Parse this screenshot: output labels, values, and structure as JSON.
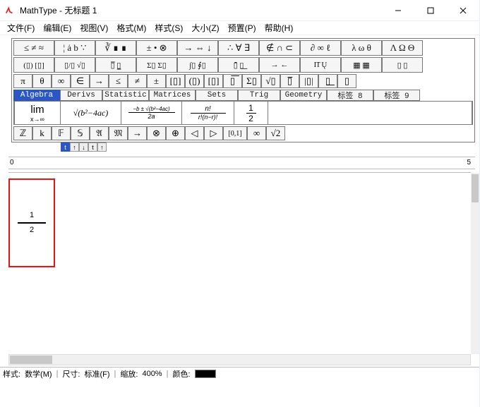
{
  "window": {
    "app_name": "MathType",
    "doc_title": "无标题 1",
    "full_title": "MathType - 无标题 1"
  },
  "menu": {
    "file": "文件(F)",
    "edit": "编辑(E)",
    "view": "视图(V)",
    "format": "格式(M)",
    "style": "样式(S)",
    "size": "大小(Z)",
    "prefs": "预置(P)",
    "help": "帮助(H)"
  },
  "palette_rows": {
    "row1": [
      "≤ ≠ ≈",
      "¦ ȧ b ∵",
      "∛ ∎ ∎",
      "± • ⊗",
      "→ ⇔ ↓",
      "∴ ∀ ∃",
      "∉ ∩ ⊂",
      "∂ ∞ ℓ",
      "λ ω θ",
      "Λ Ω Θ"
    ],
    "row2": [
      "(▯) [▯]",
      "▯/▯  √▯",
      "▯̅  ▯̲",
      "Σ▯ Σ▯",
      "∫▯ ∮▯",
      "▯̄  ▯͟",
      "→  ←",
      "Π̄  Ų",
      "▦ ▦",
      "▯ ▯"
    ]
  },
  "sym_row": [
    "π",
    "θ",
    "∞",
    "∈",
    "→",
    "≤",
    "≠",
    "±",
    "[▯]",
    "(▯)",
    "[▯]",
    "▯͞",
    "Σ▯",
    "√▯",
    "▯̅",
    "|▯|",
    "▯͟",
    "▯"
  ],
  "tabs": {
    "algebra": "Algebra",
    "derivs": "Derivs",
    "statistic": "Statistic",
    "matrices": "Matrices",
    "sets": "Sets",
    "trig": "Trig",
    "geometry": "Geometry",
    "tag8": "标签 8",
    "tag9": "标签 9"
  },
  "templates": {
    "lim": "lim",
    "lim_sub": "x→∞",
    "sqrt": "√(b²−4ac)",
    "quad_top": "−b ± √(b²−4ac)",
    "quad_bot": "2a",
    "binom_top": "n!",
    "binom_bot": "r!(n−r)!",
    "half_top": "1",
    "half_bot": "2"
  },
  "sym_row2": [
    "ℤ",
    "k",
    "𝔽",
    "𝕊",
    "𝔄",
    "𝔐",
    "→",
    "⊗",
    "⊕",
    "◁",
    "▷",
    "[0,1]",
    "∞",
    "√2"
  ],
  "ruler": {
    "left": "0",
    "right": "5"
  },
  "document": {
    "fraction": {
      "num": "1",
      "den": "2"
    }
  },
  "status": {
    "style_label": "样式:",
    "style_value": "数学(M)",
    "size_label": "尺寸:",
    "size_value": "标准(F)",
    "zoom_label": "缩放:",
    "zoom_value": "400%",
    "color_label": "颜色:"
  }
}
